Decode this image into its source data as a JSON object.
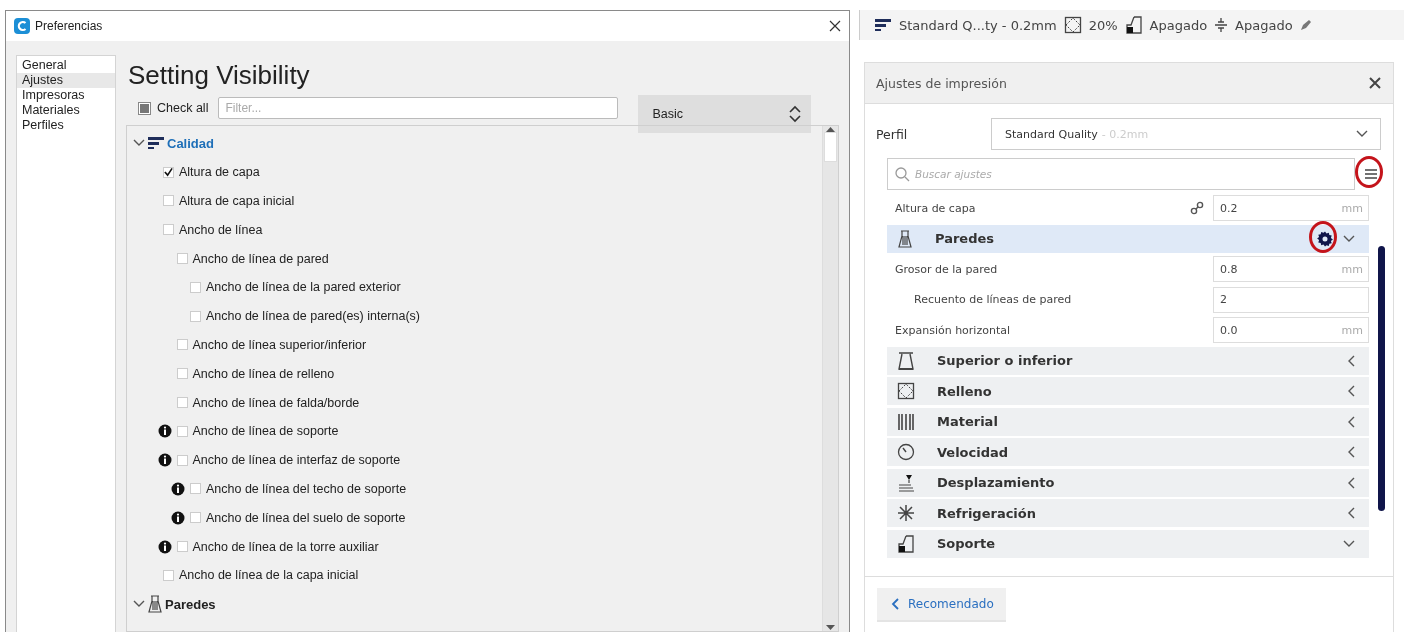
{
  "preferences": {
    "title": "Preferencias",
    "sidebar": [
      {
        "label": "General",
        "selected": false
      },
      {
        "label": "Ajustes",
        "selected": true
      },
      {
        "label": "Impresoras",
        "selected": false
      },
      {
        "label": "Materiales",
        "selected": false
      },
      {
        "label": "Perfiles",
        "selected": false
      }
    ],
    "heading": "Setting Visibility",
    "check_all": {
      "label": "Check all",
      "checked": false,
      "partial": true
    },
    "filter": {
      "placeholder": "Filter..."
    },
    "preset": {
      "value": "Basic"
    },
    "tree": [
      {
        "kind": "category",
        "label": "Calidad",
        "selected": true,
        "expanded": true,
        "children": [
          {
            "kind": "setting",
            "label": "Altura de capa",
            "checked": true,
            "info": false
          },
          {
            "kind": "setting",
            "label": "Altura de capa inicial",
            "checked": false,
            "info": false
          },
          {
            "kind": "setting",
            "label": "Ancho de línea",
            "checked": false,
            "info": false,
            "children": [
              {
                "kind": "setting",
                "label": "Ancho de línea de pared",
                "checked": false,
                "info": false,
                "children": [
                  {
                    "kind": "setting",
                    "label": "Ancho de línea de la pared exterior",
                    "checked": false,
                    "info": false
                  },
                  {
                    "kind": "setting",
                    "label": "Ancho de línea de pared(es) interna(s)",
                    "checked": false,
                    "info": false
                  }
                ]
              },
              {
                "kind": "setting",
                "label": "Ancho de línea superior/inferior",
                "checked": false,
                "info": false
              },
              {
                "kind": "setting",
                "label": "Ancho de línea de relleno",
                "checked": false,
                "info": false
              },
              {
                "kind": "setting",
                "label": "Ancho de línea de falda/borde",
                "checked": false,
                "info": false
              },
              {
                "kind": "setting",
                "label": "Ancho de línea de soporte",
                "checked": false,
                "info": true
              },
              {
                "kind": "setting",
                "label": "Ancho de línea de interfaz de soporte",
                "checked": false,
                "info": true,
                "children": [
                  {
                    "kind": "setting",
                    "label": "Ancho de línea del techo de soporte",
                    "checked": false,
                    "info": true
                  },
                  {
                    "kind": "setting",
                    "label": "Ancho de línea del suelo de soporte",
                    "checked": false,
                    "info": true
                  }
                ]
              },
              {
                "kind": "setting",
                "label": "Ancho de línea de la torre auxiliar",
                "checked": false,
                "info": true
              }
            ]
          },
          {
            "kind": "setting",
            "label": "Ancho de línea de la capa inicial",
            "checked": false,
            "info": false
          }
        ]
      },
      {
        "kind": "category",
        "label": "Paredes",
        "selected": false,
        "expanded": true
      }
    ]
  },
  "top_bar": {
    "items": [
      {
        "text": "Standard Q...ty - 0.2mm"
      },
      {
        "text": "20%"
      },
      {
        "text": "Apagado"
      },
      {
        "text": "Apagado"
      }
    ]
  },
  "print_settings": {
    "title": "Ajustes de impresión",
    "profile": {
      "label": "Perfil",
      "value": "Standard Quality",
      "detail": "- 0.2mm"
    },
    "search": {
      "placeholder": "Buscar ajustes"
    },
    "menu_annotated": true,
    "rows": [
      {
        "kind": "setting",
        "label": "Altura de capa",
        "value": "0.2",
        "unit": "mm",
        "linked": true
      },
      {
        "kind": "category",
        "label": "Paredes",
        "selected": true,
        "expanded": true,
        "annotated": true
      },
      {
        "kind": "setting",
        "label": "Grosor de la pared",
        "value": "0.8",
        "unit": "mm",
        "linked": false,
        "children": [
          {
            "kind": "setting",
            "label": "Recuento de líneas de pared",
            "value": "2",
            "linked": false
          }
        ]
      },
      {
        "kind": "setting",
        "label": "Expansión horizontal",
        "value": "0.0",
        "unit": "mm",
        "linked": false
      },
      {
        "kind": "category",
        "label": "Superior o inferior",
        "selected": false,
        "expanded": false,
        "annotated": false
      },
      {
        "kind": "category",
        "label": "Relleno",
        "selected": false,
        "expanded": false,
        "annotated": false
      },
      {
        "kind": "category",
        "label": "Material",
        "selected": false,
        "expanded": false,
        "annotated": false
      },
      {
        "kind": "category",
        "label": "Velocidad",
        "selected": false,
        "expanded": false,
        "annotated": false
      },
      {
        "kind": "category",
        "label": "Desplazamiento",
        "selected": false,
        "expanded": false,
        "annotated": false
      },
      {
        "kind": "category",
        "label": "Refrigeración",
        "selected": false,
        "expanded": false,
        "annotated": false
      },
      {
        "kind": "category",
        "label": "Soporte",
        "selected": false,
        "expanded": true,
        "annotated": false
      }
    ],
    "footer_button": "Recomendado"
  }
}
